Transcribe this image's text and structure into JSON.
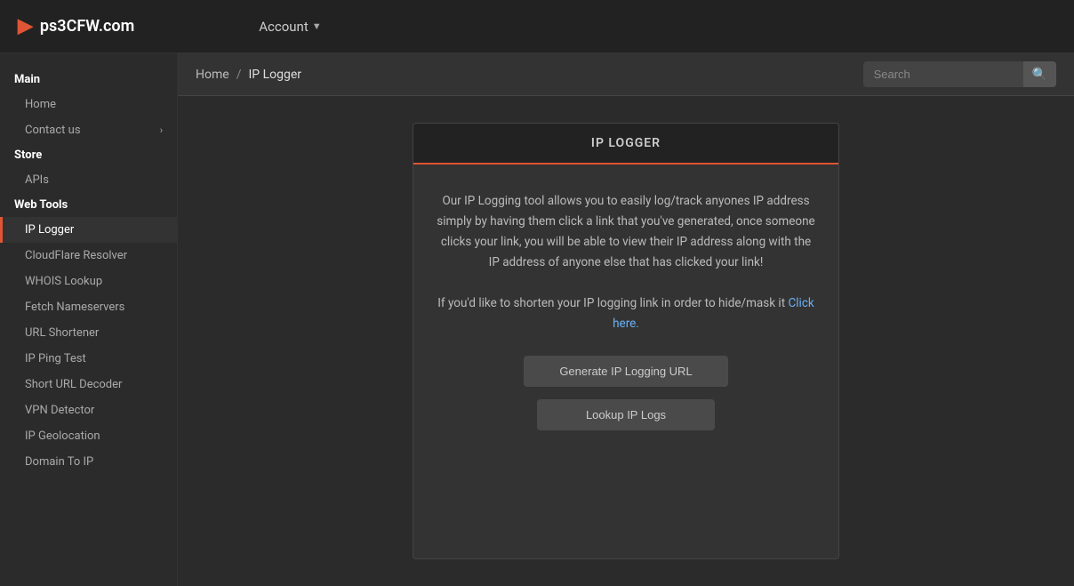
{
  "topnav": {
    "logo_icon": "▶",
    "logo_text": "ps3CFW.com",
    "account_label": "Account",
    "account_arrow": "▼"
  },
  "breadcrumb": {
    "home": "Home",
    "separator": "/",
    "current": "IP Logger"
  },
  "search": {
    "placeholder": "Search",
    "button_icon": "🔍"
  },
  "sidebar": {
    "sections": [
      {
        "label": "Main",
        "items": [
          {
            "name": "Home",
            "active": false,
            "chevron": false
          },
          {
            "name": "Contact us",
            "active": false,
            "chevron": true
          }
        ]
      },
      {
        "label": "Store",
        "items": [
          {
            "name": "APIs",
            "active": false,
            "chevron": false
          }
        ]
      },
      {
        "label": "Web Tools",
        "items": [
          {
            "name": "IP Logger",
            "active": true,
            "chevron": false
          },
          {
            "name": "CloudFlare Resolver",
            "active": false,
            "chevron": false
          },
          {
            "name": "WHOIS Lookup",
            "active": false,
            "chevron": false
          },
          {
            "name": "Fetch Nameservers",
            "active": false,
            "chevron": false
          },
          {
            "name": "URL Shortener",
            "active": false,
            "chevron": false
          },
          {
            "name": "IP Ping Test",
            "active": false,
            "chevron": false
          },
          {
            "name": "Short URL Decoder",
            "active": false,
            "chevron": false
          },
          {
            "name": "VPN Detector",
            "active": false,
            "chevron": false
          },
          {
            "name": "IP Geolocation",
            "active": false,
            "chevron": false
          },
          {
            "name": "Domain To IP",
            "active": false,
            "chevron": false
          }
        ]
      }
    ]
  },
  "tool": {
    "title": "IP LOGGER",
    "description_1": "Our IP Logging tool allows you to easily log/track anyones IP address simply by having them click a link that you've generated, once someone clicks your link, you will be able to view their IP address along with the IP address of anyone else that has clicked your link!",
    "description_2": "If you'd like to shorten your IP logging link in order to hide/mask it",
    "click_here": "Click here.",
    "btn_generate": "Generate IP Logging URL",
    "btn_lookup": "Lookup IP Logs"
  }
}
